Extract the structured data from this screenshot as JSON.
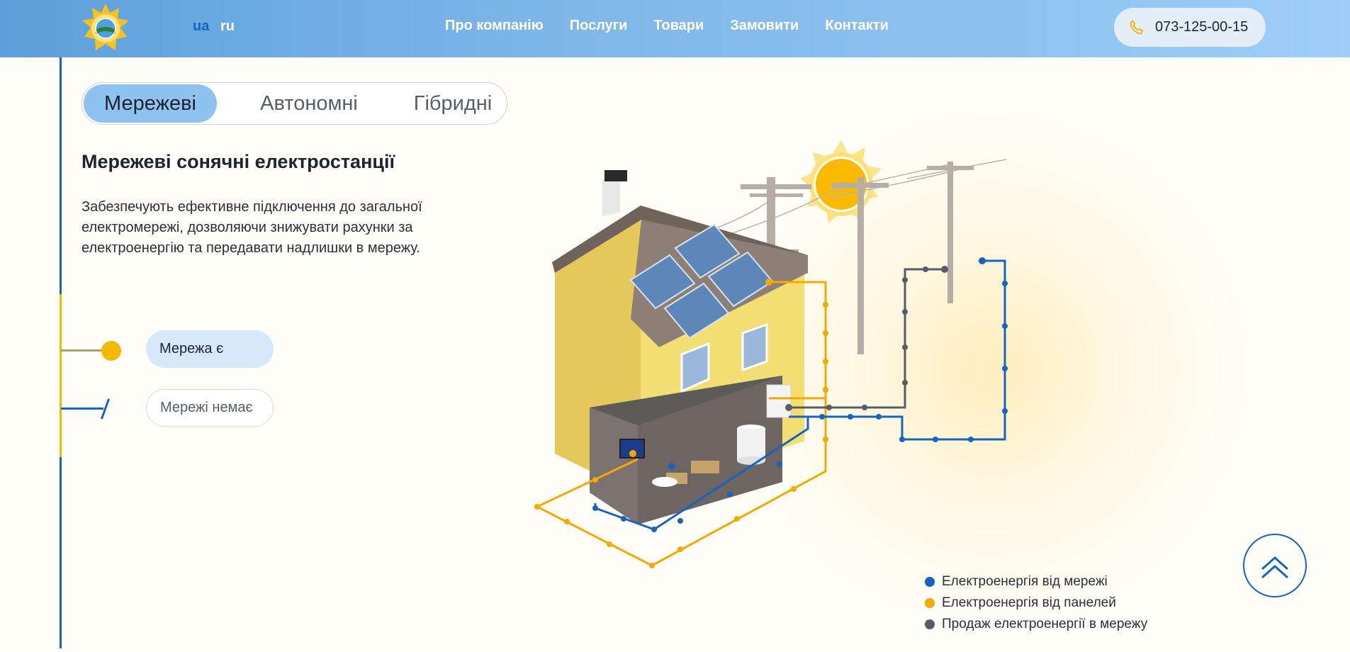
{
  "header": {
    "languages": [
      {
        "code": "ua",
        "active": true
      },
      {
        "code": "ru",
        "active": false
      }
    ],
    "nav": [
      "Про компанію",
      "Послуги",
      "Товари",
      "Замовити",
      "Контакти"
    ],
    "phone": "073-125-00-15",
    "phone_icon": "phone-icon",
    "logo_icon": "sun-logo-icon"
  },
  "tabs": [
    {
      "label": "Мережеві",
      "active": true
    },
    {
      "label": "Автономні",
      "active": false
    },
    {
      "label": "Гібридні",
      "active": false
    }
  ],
  "content": {
    "title": "Мережеві сонячні електростанції",
    "description": "Забезпечують ефективне підключення до загальної електромережі, дозволяючи знижувати рахунки за електроенергію та передавати надлишки в мережу."
  },
  "grid_options": [
    {
      "label": "Мережа є",
      "active": true
    },
    {
      "label": "Мережі немає",
      "active": false
    }
  ],
  "legend": [
    {
      "label": "Електроенергія від мережі",
      "color": "#1565c0"
    },
    {
      "label": "Електроенергія від панелей",
      "color": "#f5a800"
    },
    {
      "label": "Продаж електроенергії в мережу",
      "color": "#555e66"
    }
  ],
  "colors": {
    "header_gradient_start": "#5d9fdc",
    "accent_blue": "#1565c0",
    "accent_yellow": "#f5b800",
    "active_tab": "#8ec3ef"
  },
  "scroll_top_icon": "chevron-up-double-icon"
}
